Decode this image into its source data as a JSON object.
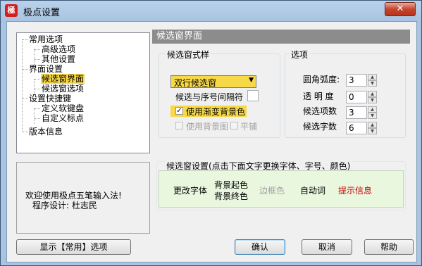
{
  "window": {
    "title": "极点设置",
    "close_label": "✕",
    "icon_glyph": "極"
  },
  "tree": {
    "items": [
      {
        "label": "常用选项"
      },
      {
        "label": "高级选项"
      },
      {
        "label": "其他设置"
      },
      {
        "label": "界面设置"
      },
      {
        "label": "候选窗界面"
      },
      {
        "label": "候选窗选项"
      },
      {
        "label": "设置快捷键"
      },
      {
        "label": "定义软键盘"
      },
      {
        "label": "自定义标点"
      },
      {
        "label": "版本信息"
      }
    ],
    "selected_index": 4
  },
  "info": {
    "line1": "欢迎使用极点五笔输入法!",
    "line2": "程序设计: 杜志民"
  },
  "panel": {
    "header": "候选窗界面",
    "style_group": {
      "label": "候选窗式样",
      "combo_value": "双行候选窗",
      "separator_label": "候选与序号间隔符",
      "gradient_label": "使用渐变背景色",
      "gradient_checked": true,
      "bgimage_label": "使用背景图",
      "tile_label": "平铺"
    },
    "options_group": {
      "label": "选项",
      "corner_label": "圆角弧度:",
      "corner_value": "3",
      "opacity_label": "透 明 度",
      "opacity_value": "0",
      "candcount_label": "候选项数",
      "candcount_value": "3",
      "charcount_label": "候选字数",
      "charcount_value": "6"
    },
    "preview_group": {
      "label": "候选窗设置(点击下面文字更换字体、字号、颜色)",
      "change_font": "更改字体",
      "bg_start": "背景起色",
      "bg_end": "背景终色",
      "border_color": "边框色",
      "auto_word": "自动词",
      "hint_info": "提示信息"
    }
  },
  "buttons": {
    "show_common": "显示【常用】选项",
    "ok": "确认",
    "cancel": "取消",
    "help": "帮助"
  },
  "colors": {
    "highlight": "#f7d948",
    "hint_red": "#c00000",
    "preview_bg": "#eaf7df"
  }
}
